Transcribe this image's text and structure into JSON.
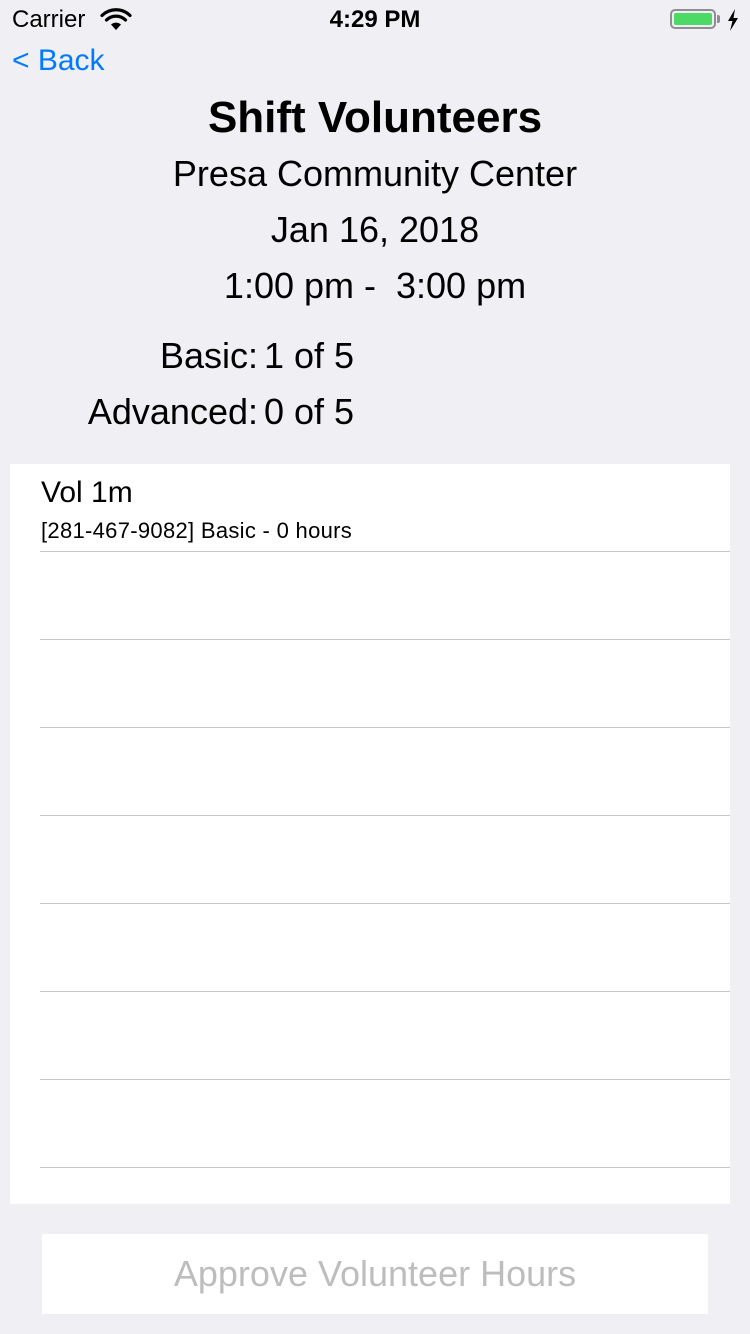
{
  "status_bar": {
    "carrier": "Carrier",
    "time": "4:29 PM",
    "battery_level": 1.0,
    "battery_color": "#4cd964"
  },
  "nav": {
    "back_label": "< Back",
    "accent_color": "#007aff"
  },
  "header": {
    "title": "Shift Volunteers",
    "location": "Presa Community Center",
    "date": "Jan 16, 2018",
    "time_range": "1:00 pm -  3:00 pm"
  },
  "stats": [
    {
      "label": "Basic:",
      "value": "1 of 5"
    },
    {
      "label": "Advanced:",
      "value": "0 of 5"
    }
  ],
  "volunteers": [
    {
      "name": "Vol 1m",
      "detail": "[281-467-9082] Basic - 0 hours"
    },
    {
      "name": "",
      "detail": ""
    },
    {
      "name": "",
      "detail": ""
    },
    {
      "name": "",
      "detail": ""
    },
    {
      "name": "",
      "detail": ""
    },
    {
      "name": "",
      "detail": ""
    },
    {
      "name": "",
      "detail": ""
    },
    {
      "name": "",
      "detail": ""
    }
  ],
  "approve_button": {
    "label": "Approve Volunteer Hours",
    "enabled": false
  }
}
